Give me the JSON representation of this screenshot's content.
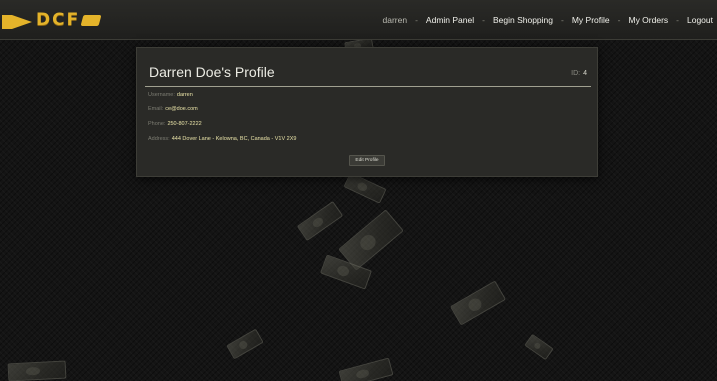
{
  "brand": {
    "logo_text": "DCF"
  },
  "nav": {
    "username": "darren",
    "separator": "-",
    "links": [
      "Admin Panel",
      "Begin Shopping",
      "My Profile",
      "My Orders",
      "Logout"
    ]
  },
  "profile": {
    "title": "Darren Doe's Profile",
    "id_label": "ID:",
    "id_value": "4",
    "fields": [
      {
        "label": "Username:",
        "value": "darren"
      },
      {
        "label": "Email:",
        "value": "ce@doe.com"
      },
      {
        "label": "Phone:",
        "value": "250-807-2222"
      },
      {
        "label": "Address:",
        "value": "444 Dover Lane - Kelowna, BC, Canada - V1V 2X9"
      }
    ],
    "edit_button": "Edit Profile"
  },
  "colors": {
    "accent": "#e4b32a",
    "card_bg": "#2a2a27",
    "value_text": "#e9e3a8"
  }
}
